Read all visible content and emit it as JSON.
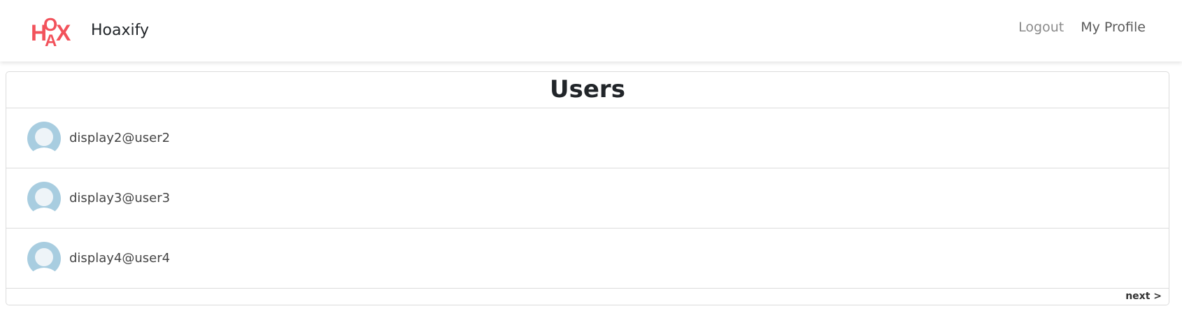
{
  "navbar": {
    "brand_name": "Hoaxify",
    "logo_text": "HOAX",
    "logo_color": "#f0353f",
    "links": [
      {
        "label": "Logout"
      },
      {
        "label": "My Profile"
      }
    ]
  },
  "users_card": {
    "title": "Users",
    "users": [
      {
        "name": "display2@user2",
        "avatar_icon": "default-profile-icon"
      },
      {
        "name": "display3@user3",
        "avatar_icon": "default-profile-icon"
      },
      {
        "name": "display4@user4",
        "avatar_icon": "default-profile-icon"
      }
    ],
    "next_label": "next >"
  },
  "colors": {
    "avatar": "#a8cde0"
  }
}
